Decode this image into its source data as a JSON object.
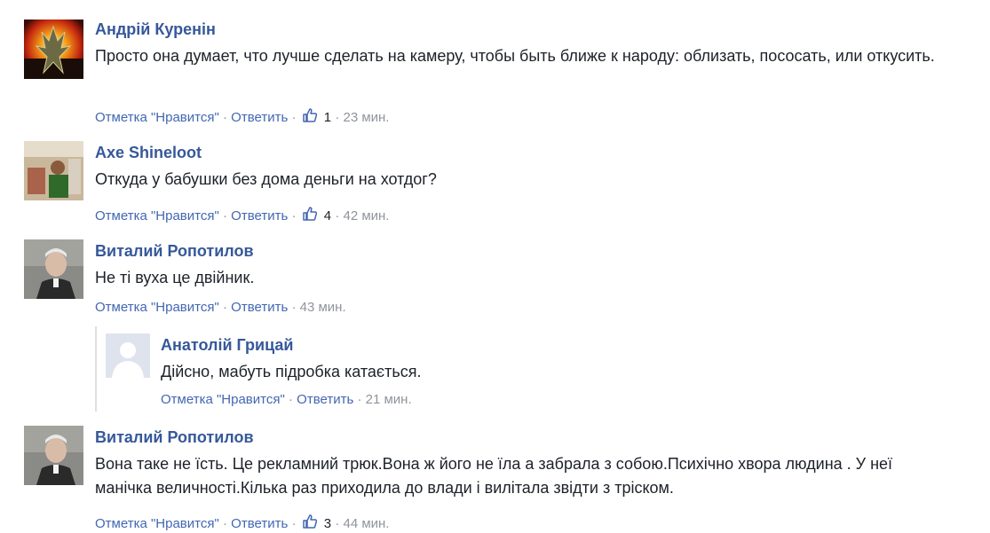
{
  "comments": [
    {
      "author": "Андрій Куренін",
      "text": "Просто она думает, что лучше сделать на камеру, чтобы быть ближе к народу: облизать, пососать, или откусить.",
      "like_label": "Отметка \"Нравится\"",
      "reply_label": "Ответить",
      "likes": "1",
      "time": "23 мин."
    },
    {
      "author": "Axe Shineloot",
      "text": "Откуда у бабушки без дома деньги на хотдог?",
      "like_label": "Отметка \"Нравится\"",
      "reply_label": "Ответить",
      "likes": "4",
      "time": "42 мин."
    },
    {
      "author": "Виталий Ропотилов",
      "text": "Не ті вуха це двійник.",
      "like_label": "Отметка \"Нравится\"",
      "reply_label": "Ответить",
      "time": "43 мин."
    },
    {
      "author": "Анатолій Грицай",
      "text": "Дійсно, мабуть підробка катається.",
      "like_label": "Отметка \"Нравится\"",
      "reply_label": "Ответить",
      "time": "21 мин."
    },
    {
      "author": "Виталий Ропотилов",
      "text": "Вона таке не їсть. Це рекламний трюк.Вона ж його не їла а забрала з собою.Психічно хвора людина . У неї манічка величності.Кілька раз приходила до влади і вилітала звідти з тріском.",
      "like_label": "Отметка \"Нравится\"",
      "reply_label": "Ответить",
      "likes": "3",
      "time": "44 мин."
    }
  ],
  "colors": {
    "author": "#365899",
    "link": "#4267b2",
    "meta": "#90949c",
    "text": "#1d2129"
  }
}
